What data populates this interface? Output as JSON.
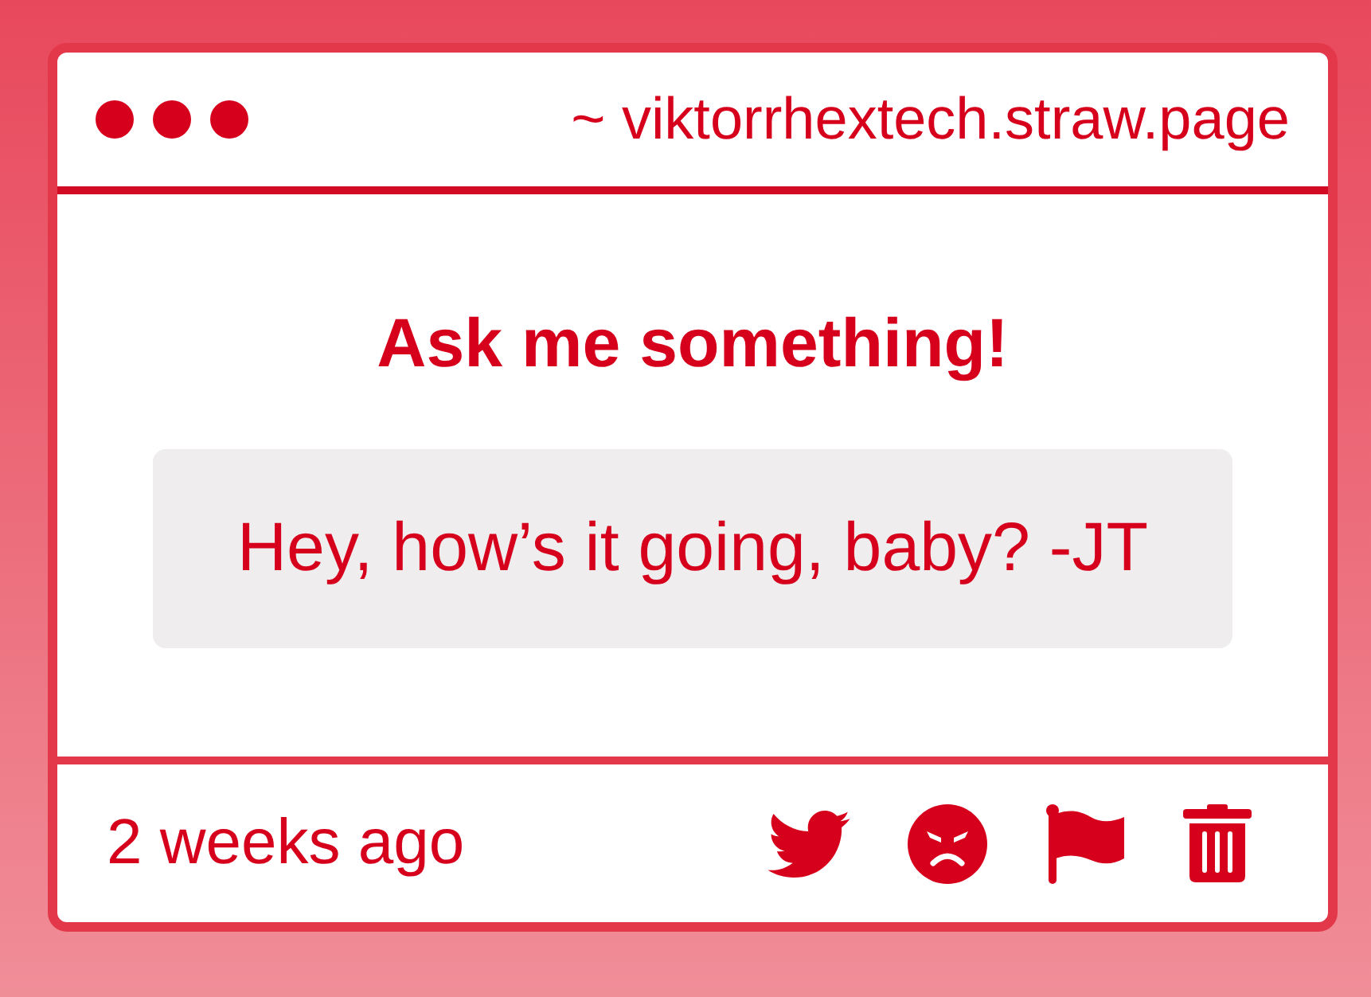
{
  "window": {
    "address": "~ viktorrhextech.straw.page"
  },
  "card": {
    "title": "Ask me something!",
    "question": "Hey, how’s it going, baby? -JT"
  },
  "footer": {
    "time": "2 weeks ago"
  }
}
